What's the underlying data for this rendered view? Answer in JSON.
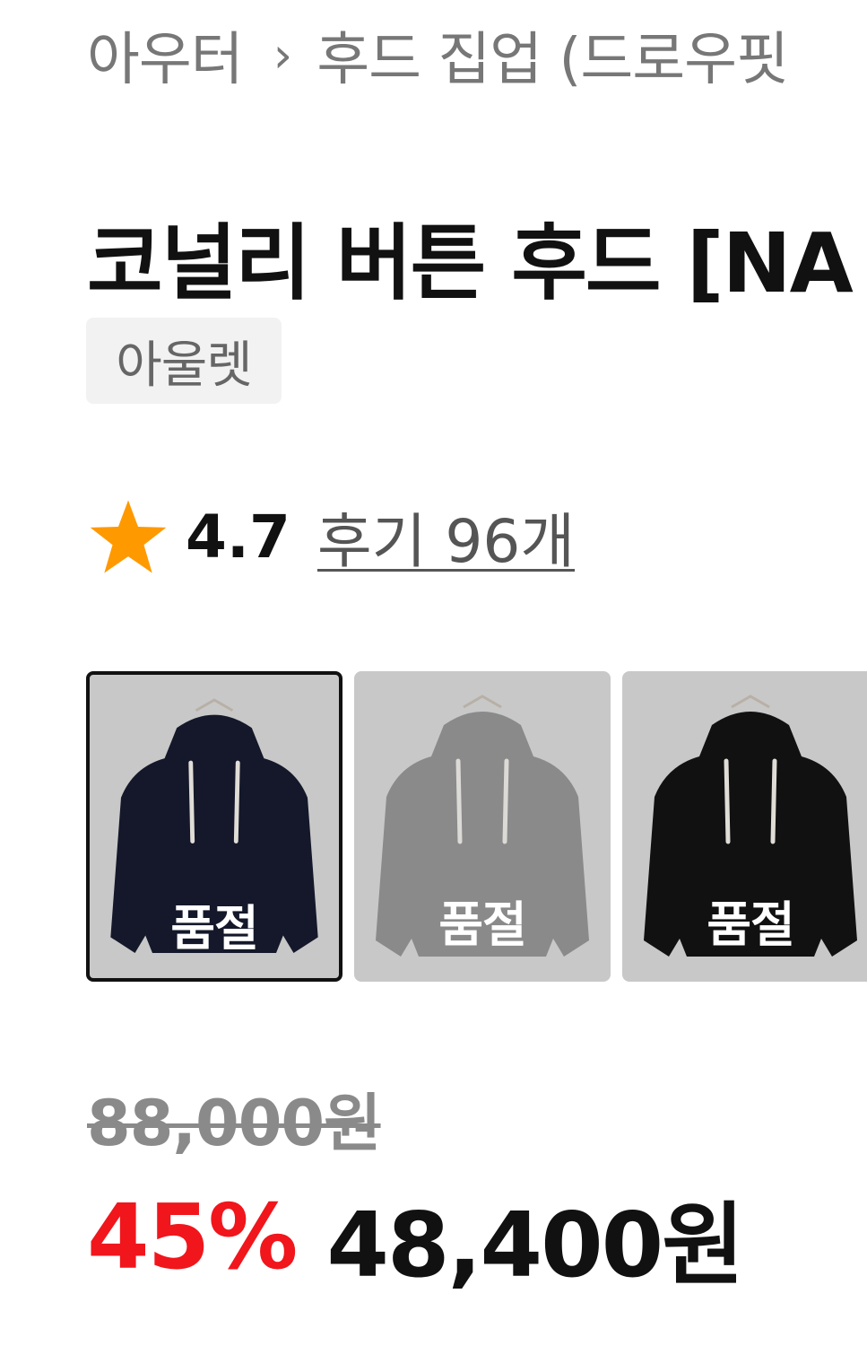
{
  "breadcrumb": {
    "category": "아우터",
    "separator": "›",
    "subcategory": "후드 집업 (드로우핏"
  },
  "product": {
    "title": "코널리 버튼 후드 [NA",
    "badge": "아울렛",
    "rating": {
      "score": "4.7",
      "reviews_label": "후기 96개"
    }
  },
  "swatches": [
    {
      "label": "품절",
      "color": "#14182a",
      "selected": true
    },
    {
      "label": "품절",
      "color": "#8a8a8a",
      "selected": false
    },
    {
      "label": "품절",
      "color": "#111111",
      "selected": false
    }
  ],
  "price": {
    "original": "88,000원",
    "discount": "45%",
    "sale": "48,400원"
  },
  "colors": {
    "star": "#ff9900",
    "discount": "#f0161c"
  },
  "icons": {
    "rating": "star-icon",
    "breadcrumb_separator": "chevron-right-icon"
  }
}
